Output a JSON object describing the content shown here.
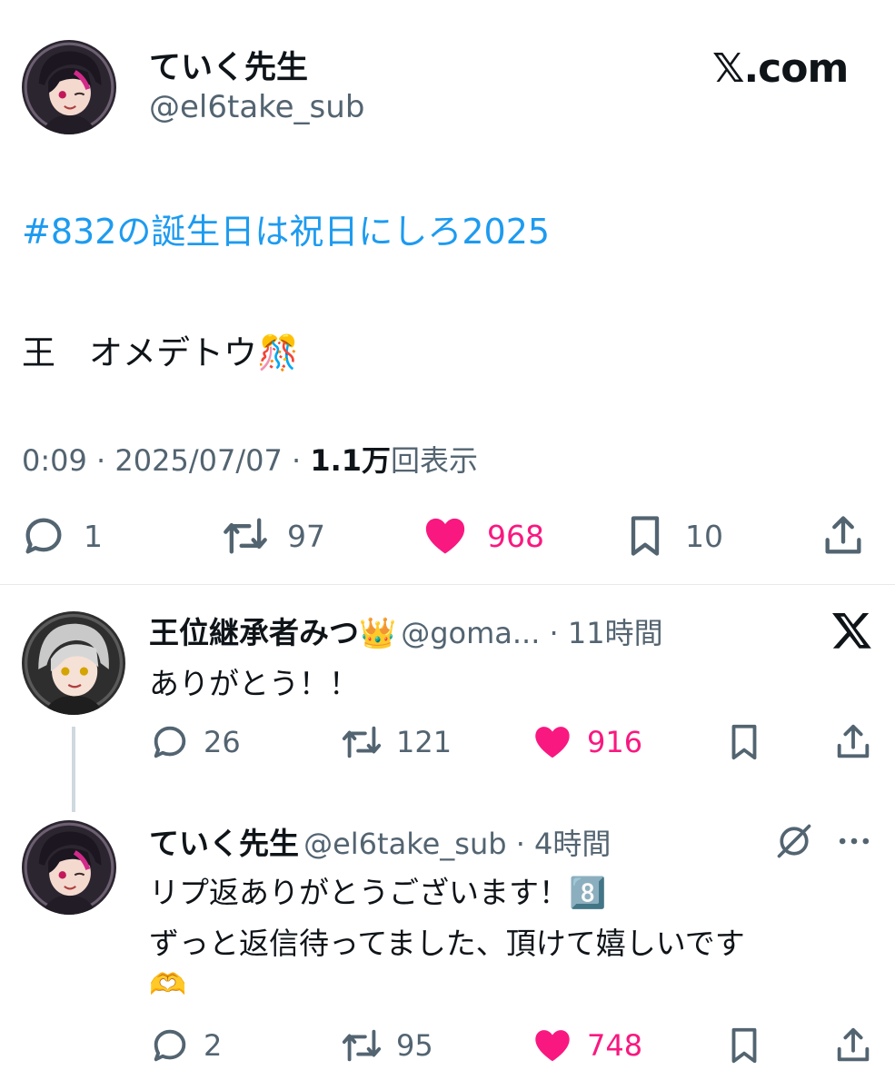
{
  "header": {
    "name": "ていく先生",
    "handle": "@el6take_sub",
    "brand": "𝕏.com"
  },
  "tweet": {
    "hashtag": "#832の誕生日は祝日にしろ2025",
    "body": "王　オメデトウ🎊",
    "time": "0:09",
    "date": "2025/07/07",
    "views_count": "1.1万",
    "views_label": "回表示",
    "separator": " · ",
    "replies": "1",
    "retweets": "97",
    "likes": "968",
    "bookmarks": "10"
  },
  "replies": [
    {
      "name": "王位継承者みつ👑",
      "handle": "@goma...",
      "time": "11時間",
      "text": "ありがとう！！",
      "replies": "26",
      "retweets": "121",
      "likes": "916"
    },
    {
      "name": "ていく先生",
      "handle": "@el6take_sub",
      "time": "4時間",
      "text_line1": "リプ返ありがとうございます！8️⃣",
      "text_line2": "ずっと返信待ってました、頂けて嬉しいです",
      "text_line3": "🫶",
      "replies": "2",
      "retweets": "95",
      "likes": "748"
    }
  ],
  "colors": {
    "link": "#1d9bf0",
    "like": "#f91880",
    "muted": "#536471",
    "text": "#0f1419"
  },
  "icons": [
    "x-logo-icon",
    "reply-icon",
    "retweet-icon",
    "heart-icon",
    "bookmark-icon",
    "share-icon",
    "grok-icon",
    "more-icon"
  ]
}
